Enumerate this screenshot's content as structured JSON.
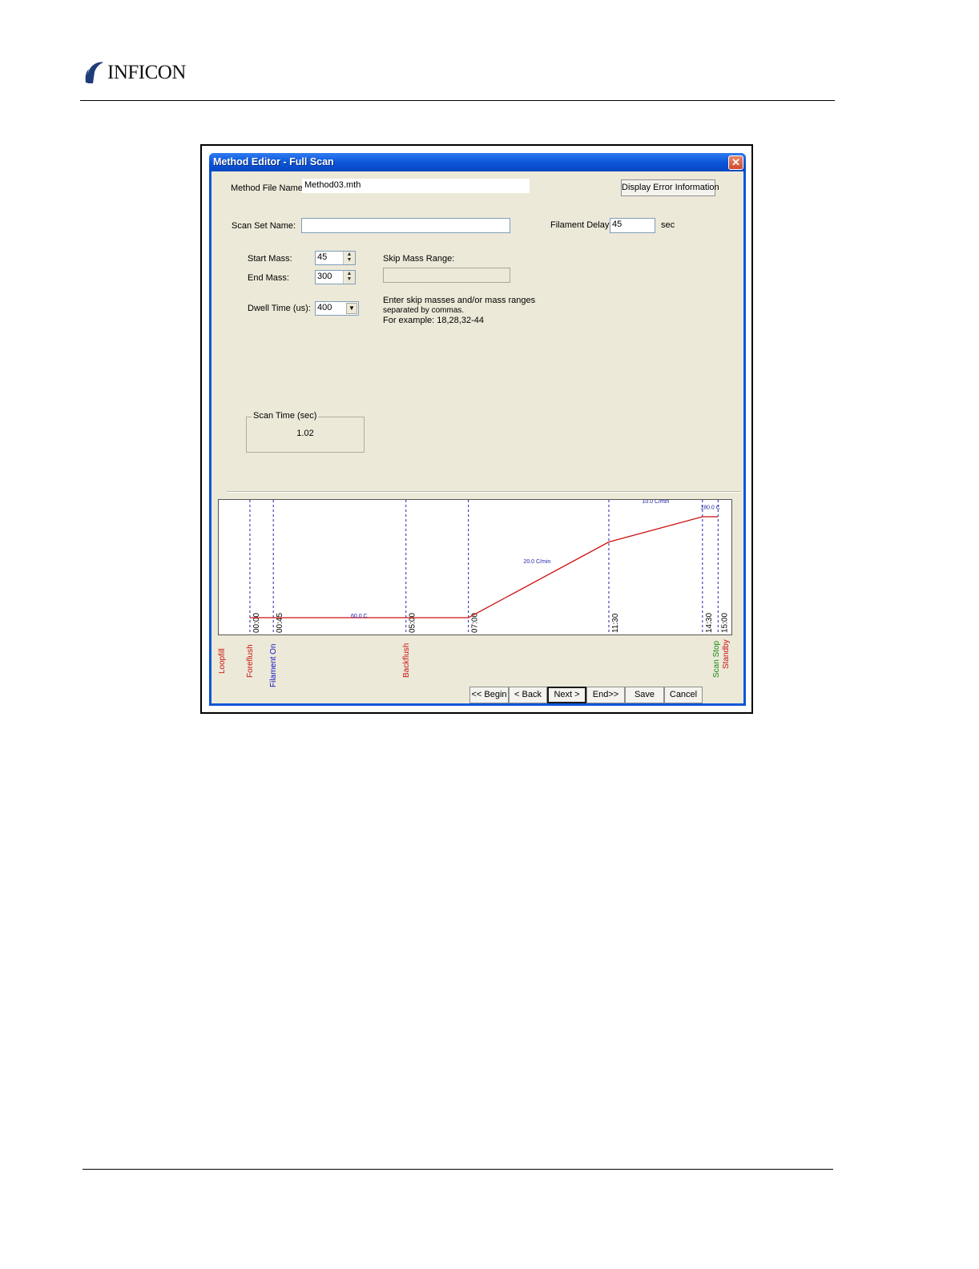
{
  "header": {
    "logo_text": "INFICON"
  },
  "window": {
    "title": "Method Editor - Full Scan",
    "close_icon": "close-icon"
  },
  "form": {
    "method_file_label": "Method File Name:",
    "method_file_value": "Method03.mth",
    "display_error_button": "Display Error Information",
    "scan_set_label": "Scan Set Name:",
    "scan_set_value": "",
    "filament_delay_label": "Filament Delay:",
    "filament_delay_value": "45",
    "filament_delay_unit": "sec",
    "start_mass_label": "Start Mass:",
    "start_mass_value": "45",
    "end_mass_label": "End Mass:",
    "end_mass_value": "300",
    "dwell_time_label": "Dwell Time (us):",
    "dwell_time_value": "400",
    "skip_mass_label": "Skip Mass Range:",
    "skip_mass_value": "",
    "help_line1": "Enter skip masses and/or mass ranges",
    "help_line2": "separated by commas.",
    "help_line3": "For example: 18,28,32-44",
    "scan_time_label": "Scan Time (sec)",
    "scan_time_value": "1.02"
  },
  "chart_data": {
    "type": "line",
    "x_unit": "min",
    "series": [
      {
        "x": [
          0,
          7,
          11.5,
          14.5,
          15
        ],
        "y": [
          60,
          60,
          150,
          180,
          180
        ]
      }
    ],
    "ylim": [
      40,
      200
    ],
    "xlim": [
      -1,
      15.3
    ],
    "time_markers": [
      {
        "t": 0,
        "label": "00:00"
      },
      {
        "t": 0.75,
        "label": "00:45"
      },
      {
        "t": 5,
        "label": "05:00"
      },
      {
        "t": 7,
        "label": "07:00"
      },
      {
        "t": 11.5,
        "label": "11:30"
      },
      {
        "t": 14.5,
        "label": "14:30"
      },
      {
        "t": 15,
        "label": "15:00"
      }
    ],
    "annotations": [
      {
        "text": "60.0 C",
        "t": 3.5,
        "y": 60
      },
      {
        "text": "20.0 C/min",
        "t": 9.2,
        "y": 125
      },
      {
        "text": "10.0 C/min",
        "t": 13.0,
        "y": 196
      },
      {
        "text": "180.0 C",
        "t": 14.75,
        "y": 189
      }
    ],
    "events": [
      {
        "label": "Loopfill",
        "t": -0.85,
        "color": "#cc1111"
      },
      {
        "label": "Foreflush",
        "t": 0.05,
        "color": "#cc1111"
      },
      {
        "label": "Filament On",
        "t": 0.8,
        "color": "#1111cc"
      },
      {
        "label": "Backflush",
        "t": 5.05,
        "color": "#cc1111"
      },
      {
        "label": "Scan Stop",
        "t": 15.0,
        "color": "#118811"
      },
      {
        "label": "Standby",
        "t": 15.3,
        "color": "#cc1111"
      }
    ],
    "colors": {
      "line": "#cc1111",
      "marker": "#2222aa",
      "annotation": "#2222aa"
    }
  },
  "footer_buttons": {
    "begin": "<< Begin",
    "back": "< Back",
    "next": "Next >",
    "end": "End>>",
    "save": "Save",
    "cancel": "Cancel"
  }
}
